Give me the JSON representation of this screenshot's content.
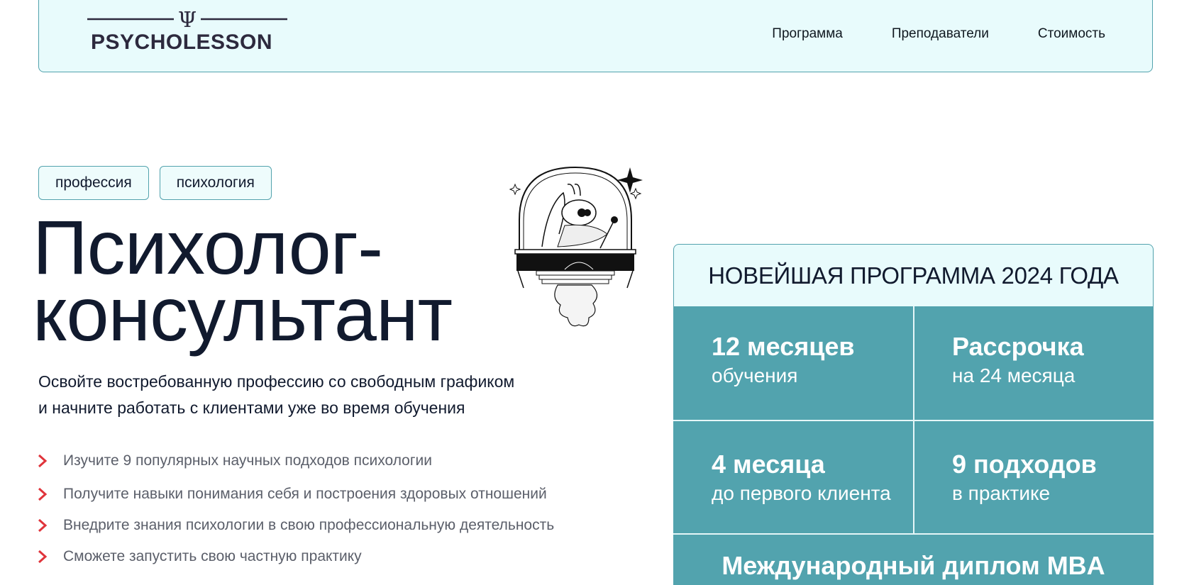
{
  "header": {
    "logo_symbol": "Ψ",
    "logo_text": "PSYCHOLESSON",
    "nav": [
      "Программа",
      "Преподаватели",
      "Стоимость"
    ]
  },
  "tags": [
    "профессия",
    "психология"
  ],
  "headline": {
    "line1": "Психолог-",
    "line2": "консультант"
  },
  "subtitle": {
    "line1": "Освойте востребованную профессию со свободным графиком",
    "line2": "и начните работать с клиентами уже во время обучения"
  },
  "bullets": [
    "Изучите 9 популярных научных подходов психологии",
    "Получите навыки понимания себя и построения здоровых отношений",
    "Внедрите знания психологии в свою профессиональную деятельность",
    "Сможете запустить свою частную практику"
  ],
  "card": {
    "title": "НОВЕЙШАЯ ПРОГРАММА 2024 ГОДА",
    "cells": [
      {
        "big": "12 месяцев",
        "small": "обучения"
      },
      {
        "big": "Рассрочка",
        "small": "на 24 месяца"
      },
      {
        "big": "4 месяца",
        "small": "до первого клиента"
      },
      {
        "big": "9 подходов",
        "small": "в практике"
      }
    ],
    "bottom": "Международный диплом MBA"
  },
  "icons": {
    "bullet": "chevron-right-icon",
    "illustration": "bell-jar-character-illustration"
  },
  "colors": {
    "accent_teal": "#52a3ae",
    "header_bg": "#e8fbfc",
    "bullet_red": "#e0343b",
    "text_dark": "#111a2e"
  }
}
